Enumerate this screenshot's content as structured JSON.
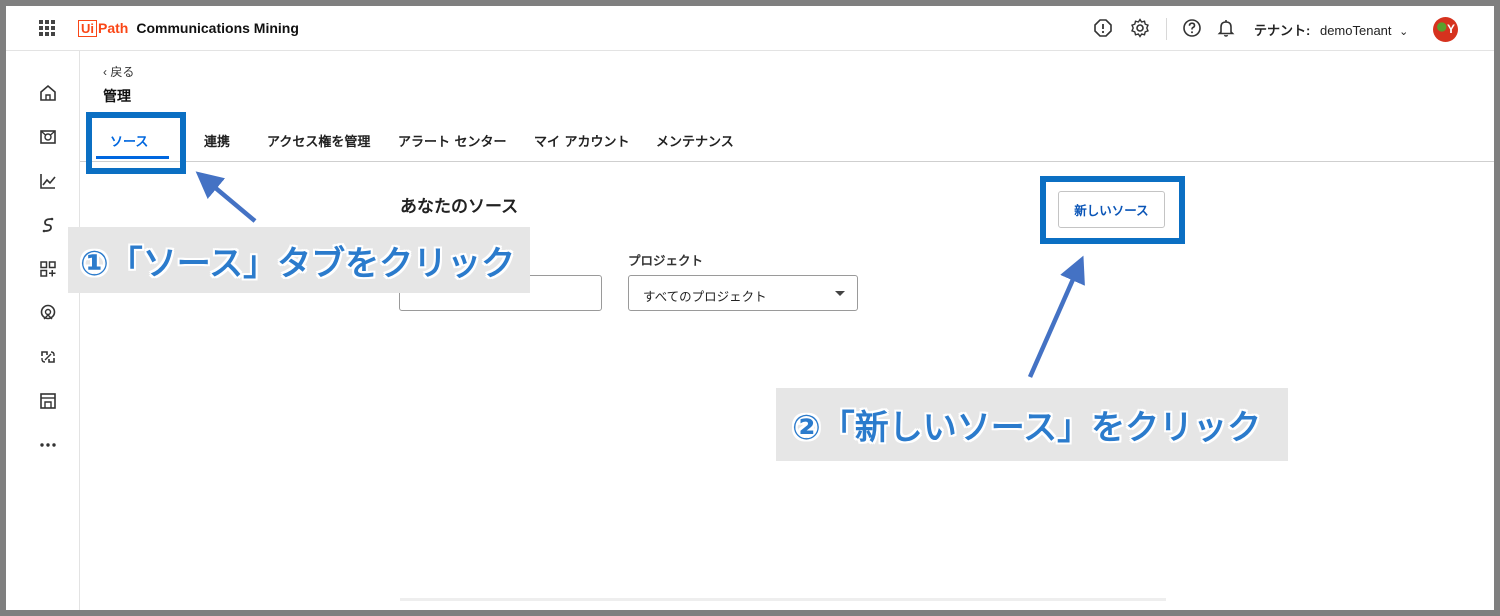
{
  "app": {
    "logo_ui": "Ui",
    "logo_path": "Path",
    "name": "Communications Mining"
  },
  "header": {
    "tenant_label": "テナント:",
    "tenant_name": "demoTenant",
    "tenant_caret": "⌄",
    "avatar_initial": "Y",
    "icons": [
      "waffle-icon",
      "alert-icon",
      "settings-icon",
      "help-icon",
      "bell-icon",
      "chevron-down-icon",
      "avatar"
    ]
  },
  "rail": {
    "icons": [
      "home-icon",
      "inbox-icon",
      "chart-icon",
      "flow-icon",
      "add-widget-icon",
      "location-icon",
      "integration-icon",
      "store-icon",
      "more-icon"
    ]
  },
  "page": {
    "back_label": "‹ 戻る",
    "title": "管理"
  },
  "tabs": [
    {
      "label": "ソース",
      "active": true
    },
    {
      "label": "連携"
    },
    {
      "label": "アクセス権を管理"
    },
    {
      "label": "アラート センター"
    },
    {
      "label": "マイ アカウント"
    },
    {
      "label": "メンテナンス"
    }
  ],
  "main": {
    "section_title": "あなたのソース",
    "new_source_button": "新しいソース",
    "project_label": "プロジェクト",
    "search_value": "",
    "project_select_value": "すべてのプロジェクト"
  },
  "annotations": {
    "step1": "①「ソース」タブをクリック",
    "step2": "②「新しいソース」をクリック",
    "highlight_color": "#0b6fc3",
    "arrow_color": "#4472c4",
    "callout_text_color": "#2b7bcc"
  }
}
